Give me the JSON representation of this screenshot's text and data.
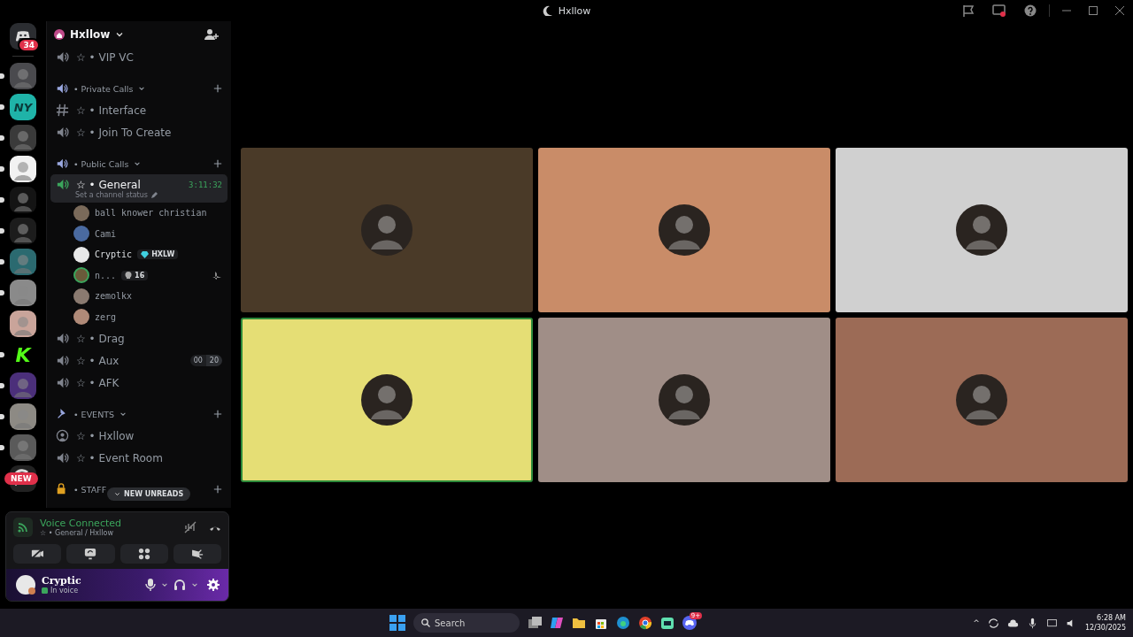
{
  "window": {
    "title": "Hxllow"
  },
  "servers": [
    {
      "kind": "home",
      "badge": "34",
      "unread": false
    },
    {
      "kind": "icon",
      "color": "#4a4a4e",
      "unread": true
    },
    {
      "kind": "logo",
      "label": "NY",
      "color": "#1fb3a8",
      "unread": true
    },
    {
      "kind": "icon",
      "color": "#3a3a3a",
      "unread": true
    },
    {
      "kind": "icon",
      "color": "#f2f2f2",
      "unread": true
    },
    {
      "kind": "icon",
      "color": "#141414",
      "unread": true
    },
    {
      "kind": "icon",
      "color": "#1c1c1c",
      "unread": true
    },
    {
      "kind": "icon",
      "color": "#2b6a70",
      "unread": true
    },
    {
      "kind": "icon",
      "color": "#8a8a8a",
      "unread": true
    },
    {
      "kind": "icon",
      "color": "#c9a49a",
      "unread": false
    },
    {
      "kind": "logo",
      "label": "K",
      "color": "#000000",
      "unread": true
    },
    {
      "kind": "icon",
      "color": "#4b2f7a",
      "unread": true
    },
    {
      "kind": "icon",
      "color": "#8d8a84",
      "unread": true
    },
    {
      "kind": "icon",
      "color": "#5a5a5a",
      "unread": true
    },
    {
      "kind": "new",
      "label": "NEW",
      "color": "#222222",
      "unread": false
    }
  ],
  "server": {
    "name": "Hxllow"
  },
  "channels": [
    {
      "kind": "voice",
      "name": "☆ • VIP VC",
      "selected": false
    },
    {
      "kind": "category",
      "name": "• Private Calls"
    },
    {
      "kind": "text",
      "name": "☆ • Interface",
      "selected": false
    },
    {
      "kind": "voice",
      "name": "☆ • Join To Create",
      "selected": false
    },
    {
      "kind": "category",
      "name": "• Public Calls"
    },
    {
      "kind": "voice",
      "name": "☆ • General",
      "selected": true,
      "timer": "3:11:32",
      "status": "Set a channel status",
      "members": [
        {
          "name": "ball knower christian",
          "color": "#7a6a5a",
          "speaking": false
        },
        {
          "name": "Cami",
          "color": "#4a6aa0",
          "speaking": false
        },
        {
          "name": "Cryptic",
          "color": "#e8e8e8",
          "speaking": false,
          "tag": "HXLW"
        },
        {
          "name": "n...",
          "color": "#6a5a3a",
          "speaking": true,
          "badge": "16",
          "console": true
        },
        {
          "name": "zemolkx",
          "color": "#8a7a70",
          "speaking": false
        },
        {
          "name": "zerg",
          "color": "#b08a78",
          "speaking": false
        }
      ]
    },
    {
      "kind": "voice",
      "name": "☆ • Drag",
      "selected": false
    },
    {
      "kind": "voice",
      "name": "☆ • Aux",
      "selected": false,
      "limit": [
        "00",
        "20"
      ]
    },
    {
      "kind": "voice",
      "name": "☆ • AFK",
      "selected": false
    },
    {
      "kind": "events",
      "name": "• EVENTS"
    },
    {
      "kind": "stage",
      "name": "☆ • Hxllow",
      "selected": false
    },
    {
      "kind": "voice",
      "name": "☆ • Event Room",
      "selected": false
    },
    {
      "kind": "locked",
      "name": "• STAFF"
    }
  ],
  "new_unreads": "NEW UNREADS",
  "voice_panel": {
    "status": "Voice Connected",
    "location": "☆ • General / Hxllow"
  },
  "user": {
    "name": "Cryptic",
    "status": "In voice"
  },
  "tiles": [
    {
      "color": "#4a3a28",
      "speaking": false
    },
    {
      "color": "#c98c68",
      "speaking": false
    },
    {
      "color": "#d0d0d0",
      "speaking": false
    },
    {
      "color": "#e5de75",
      "speaking": true
    },
    {
      "color": "#a08e87",
      "speaking": false
    },
    {
      "color": "#9c6b56",
      "speaking": false
    }
  ],
  "taskbar": {
    "search": {
      "placeholder": "Search"
    },
    "discord_badge": "9+",
    "tray_chevron": "^",
    "time": "6:28 AM",
    "date": "12/30/2025"
  }
}
